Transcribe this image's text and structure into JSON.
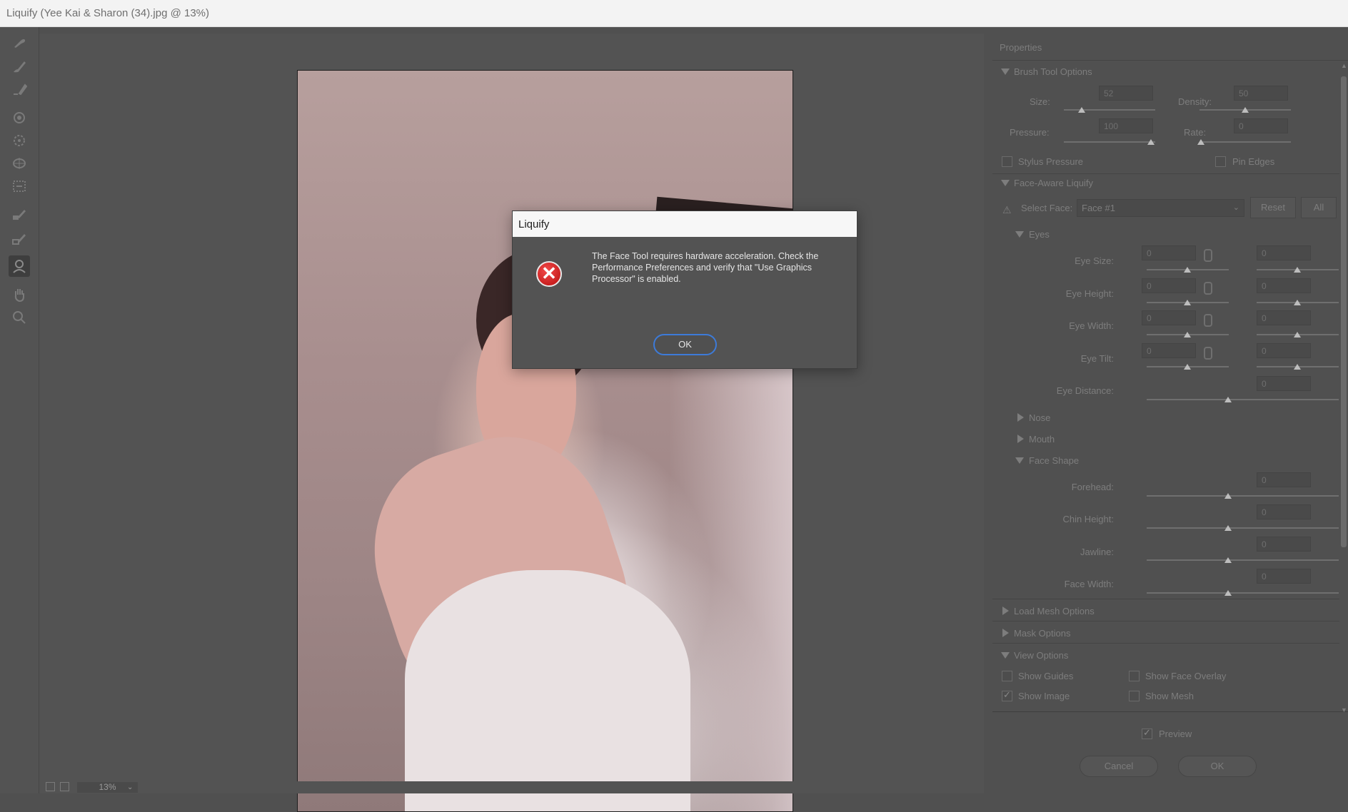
{
  "window": {
    "title": "Liquify (Yee Kai & Sharon (34).jpg @ 13%)"
  },
  "tools": [
    {
      "name": "forward-warp-tool",
      "icon": "warp-icon"
    },
    {
      "name": "reconstruct-tool",
      "icon": "brush-icon"
    },
    {
      "name": "smooth-tool",
      "icon": "smooth-brush-icon"
    },
    {
      "name": "twirl-tool",
      "icon": "twirl-icon"
    },
    {
      "name": "pucker-tool",
      "icon": "pucker-icon"
    },
    {
      "name": "bloat-tool",
      "icon": "bloat-icon"
    },
    {
      "name": "push-left-tool",
      "icon": "push-left-icon"
    },
    {
      "name": "freeze-mask-tool",
      "icon": "freeze-mask-icon"
    },
    {
      "name": "thaw-mask-tool",
      "icon": "thaw-mask-icon"
    },
    {
      "name": "face-tool",
      "icon": "face-icon",
      "active": true
    },
    {
      "name": "hand-tool",
      "icon": "hand-icon"
    },
    {
      "name": "zoom-tool",
      "icon": "zoom-icon"
    }
  ],
  "statusbar": {
    "zoom": "13%"
  },
  "properties": {
    "header": "Properties",
    "brush": {
      "title": "Brush Tool Options",
      "size_label": "Size:",
      "size": "52",
      "density_label": "Density:",
      "density": "50",
      "pressure_label": "Pressure:",
      "pressure": "100",
      "rate_label": "Rate:",
      "rate": "0",
      "stylus_label": "Stylus Pressure",
      "pin_label": "Pin Edges"
    },
    "face": {
      "title": "Face-Aware Liquify",
      "select_label": "Select Face:",
      "select_value": "Face #1",
      "reset": "Reset",
      "all": "All",
      "eyes": {
        "title": "Eyes",
        "rows": [
          {
            "label": "Eye Size:",
            "left": "0",
            "right": "0"
          },
          {
            "label": "Eye Height:",
            "left": "0",
            "right": "0"
          },
          {
            "label": "Eye Width:",
            "left": "0",
            "right": "0"
          },
          {
            "label": "Eye Tilt:",
            "left": "0",
            "right": "0"
          }
        ],
        "distance_label": "Eye Distance:",
        "distance": "0"
      },
      "nose": "Nose",
      "mouth": "Mouth",
      "shape": {
        "title": "Face Shape",
        "rows": [
          {
            "label": "Forehead:",
            "value": "0"
          },
          {
            "label": "Chin Height:",
            "value": "0"
          },
          {
            "label": "Jawline:",
            "value": "0"
          },
          {
            "label": "Face Width:",
            "value": "0"
          }
        ]
      }
    },
    "load_mesh": "Load Mesh Options",
    "mask": "Mask Options",
    "view": {
      "title": "View Options",
      "show_guides": "Show Guides",
      "show_face_overlay": "Show Face Overlay",
      "show_image": "Show Image",
      "show_mesh": "Show Mesh"
    },
    "preview": "Preview",
    "cancel": "Cancel",
    "ok": "OK"
  },
  "dialog": {
    "title": "Liquify",
    "message": "The Face Tool requires hardware acceleration. Check the Performance Preferences and verify that \"Use Graphics Processor\" is enabled.",
    "ok": "OK"
  }
}
